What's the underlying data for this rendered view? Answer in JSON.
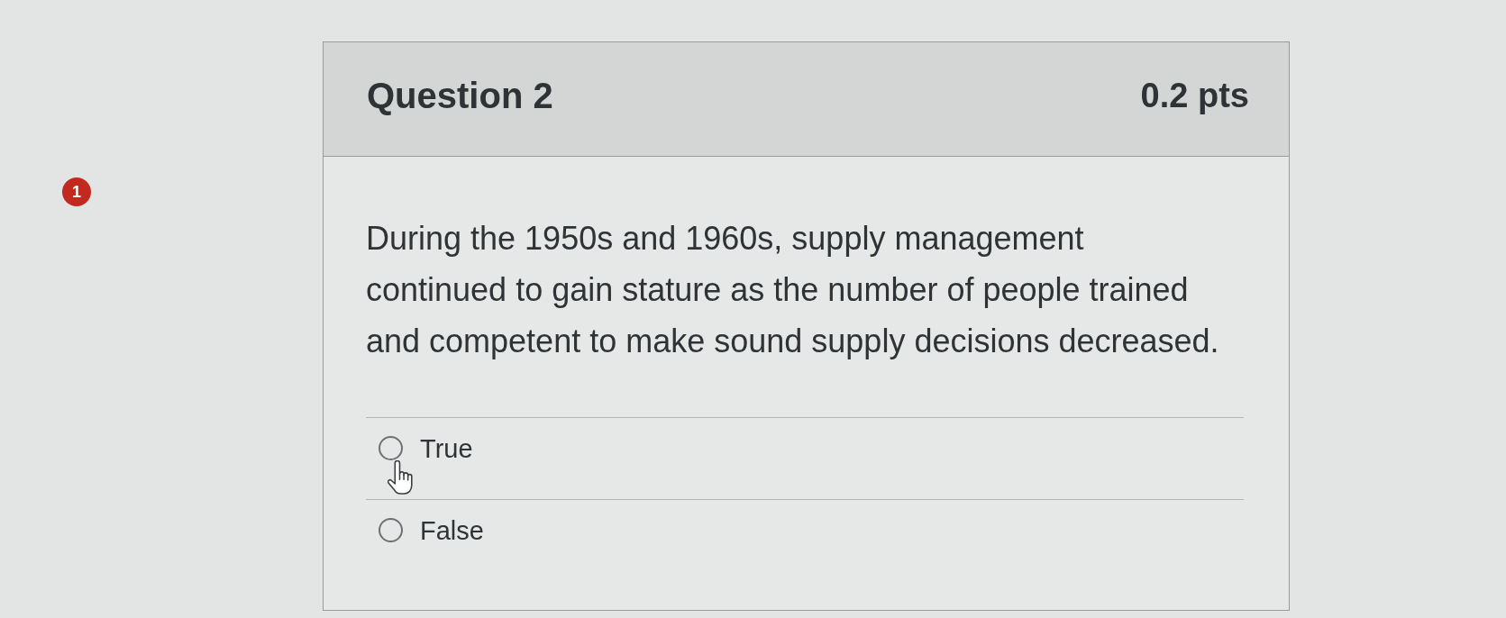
{
  "notification_badge": {
    "count": "1"
  },
  "question": {
    "title": "Question 2",
    "points": "0.2 pts",
    "text": "During the 1950s and 1960s, supply management continued to gain stature as the number of people trained and competent to make sound supply decisions decreased.",
    "answers": [
      {
        "label": "True",
        "selected": false,
        "hovered": true
      },
      {
        "label": "False",
        "selected": false,
        "hovered": false
      }
    ]
  }
}
